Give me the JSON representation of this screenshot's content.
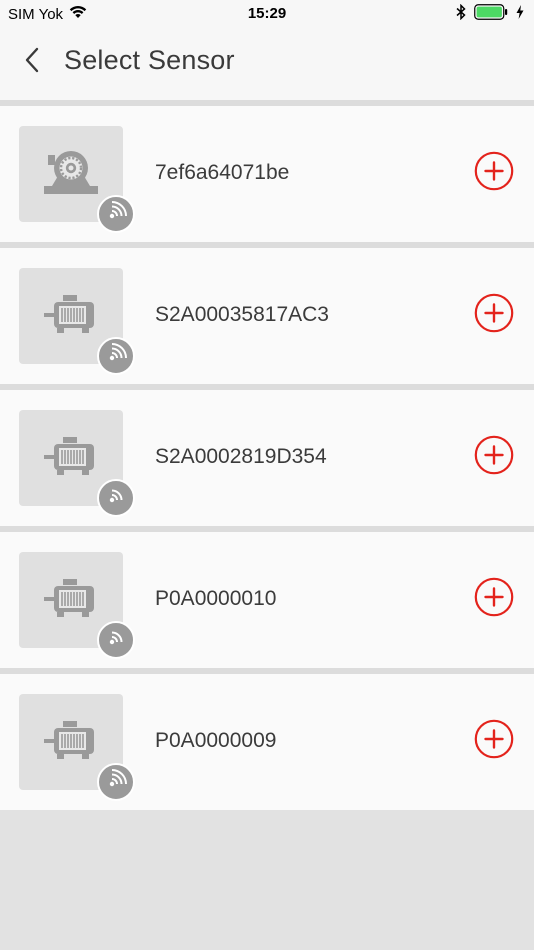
{
  "status_bar": {
    "carrier": "SIM Yok",
    "time": "15:29"
  },
  "nav": {
    "title": "Select Sensor",
    "back_icon": "chevron-left-icon"
  },
  "colors": {
    "accent": "#e3231c",
    "thumb_bg": "#e0e0e0",
    "badge": "#9a9a9a",
    "battery": "#4cd964"
  },
  "sensors": [
    {
      "name": "7ef6a64071be",
      "icon": "bearing-icon"
    },
    {
      "name": "S2A00035817AC3",
      "icon": "motor-icon"
    },
    {
      "name": "S2A0002819D354",
      "icon": "motor-icon"
    },
    {
      "name": "P0A0000010",
      "icon": "motor-icon"
    },
    {
      "name": "P0A0000009",
      "icon": "motor-icon"
    }
  ]
}
